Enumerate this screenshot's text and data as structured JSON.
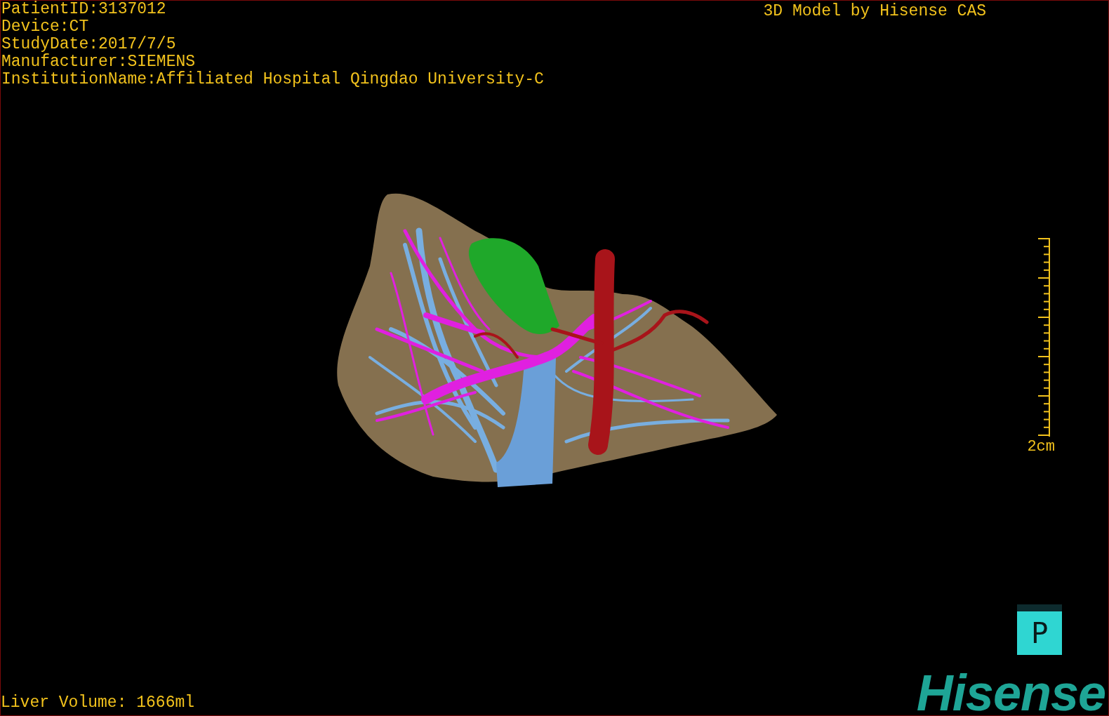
{
  "study_info": [
    "PatientID:3137012",
    "Device:CT",
    "StudyDate:2017/7/5",
    "Manufacturer:SIEMENS",
    "InstitutionName:Affiliated Hospital Qingdao University-C"
  ],
  "title": "3D Model by Hisense CAS",
  "scale_bar": {
    "label": "2cm"
  },
  "orientation_cube": {
    "label": "P"
  },
  "liver_volume": "Liver Volume: 1666ml",
  "logo": "Hisense"
}
